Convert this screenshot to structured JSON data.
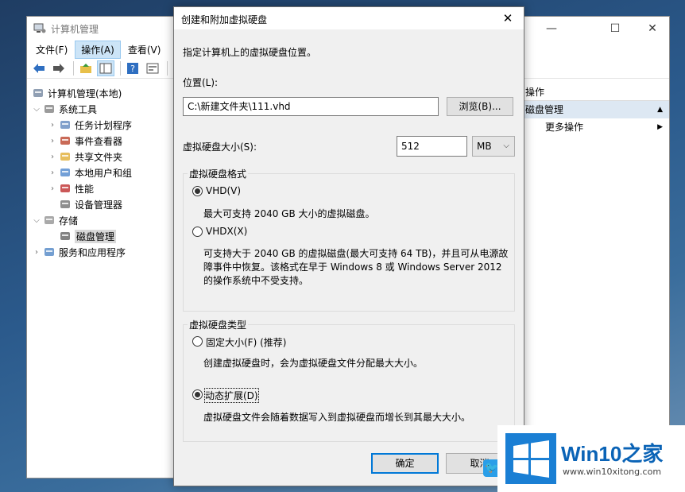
{
  "main_window": {
    "title": "计算机管理",
    "menu": [
      "文件(F)",
      "操作(A)",
      "查看(V)",
      "帮"
    ],
    "active_menu_index": 1,
    "tree": [
      {
        "label": "计算机管理(本地)",
        "level": 0,
        "expander": "",
        "icon": "computer-management-icon"
      },
      {
        "label": "系统工具",
        "level": 1,
        "expander": "down",
        "icon": "tools-icon"
      },
      {
        "label": "任务计划程序",
        "level": 2,
        "expander": "right",
        "icon": "task-scheduler-icon"
      },
      {
        "label": "事件查看器",
        "level": 2,
        "expander": "right",
        "icon": "event-viewer-icon"
      },
      {
        "label": "共享文件夹",
        "level": 2,
        "expander": "right",
        "icon": "shared-folder-icon"
      },
      {
        "label": "本地用户和组",
        "level": 2,
        "expander": "right",
        "icon": "users-icon"
      },
      {
        "label": "性能",
        "level": 2,
        "expander": "right",
        "icon": "performance-icon"
      },
      {
        "label": "设备管理器",
        "level": 2,
        "expander": "",
        "icon": "device-manager-icon"
      },
      {
        "label": "存储",
        "level": 1,
        "expander": "down",
        "icon": "storage-icon"
      },
      {
        "label": "磁盘管理",
        "level": 2,
        "expander": "",
        "icon": "disk-icon",
        "selected": true
      },
      {
        "label": "服务和应用程序",
        "level": 1,
        "expander": "right",
        "icon": "services-icon"
      }
    ],
    "actions": {
      "header": "操作",
      "section": "磁盘管理",
      "item": "更多操作"
    }
  },
  "dialog": {
    "title": "创建和附加虚拟硬盘",
    "instruction": "指定计算机上的虚拟硬盘位置。",
    "location_label": "位置(L):",
    "location_value": "C:\\新建文件夹\\111.vhd",
    "browse_button": "浏览(B)...",
    "size_label": "虚拟硬盘大小(S):",
    "size_value": "512",
    "size_unit": "MB",
    "format_group": "虚拟硬盘格式",
    "format_vhd": "VHD(V)",
    "format_vhd_desc": "最大可支持 2040 GB 大小的虚拟磁盘。",
    "format_vhdx": "VHDX(X)",
    "format_vhdx_desc": [
      "可支持大于 2040 GB 的虚拟磁盘(最大可支持 64 TB)，并且可从电源故",
      "障事件中恢复。该格式在早于 Windows 8 或 Windows Server 2012",
      "的操作系统中不受支持。"
    ],
    "format_selected": "VHD",
    "type_group": "虚拟硬盘类型",
    "type_fixed": "固定大小(F) (推荐)",
    "type_fixed_desc": "创建虚拟硬盘时，会为虚拟硬盘文件分配最大大小。",
    "type_dynamic": "动态扩展(D)",
    "type_dynamic_desc": "虚拟硬盘文件会随着数据写入到虚拟硬盘而增长到其最大大小。",
    "type_selected": "dynamic",
    "ok_button": "确定",
    "cancel_button": "取消"
  },
  "watermark": {
    "brand_latin": "Win10",
    "brand_zh": "之家",
    "url": "www.win10xitong.com",
    "accent": "#0a63b6"
  }
}
